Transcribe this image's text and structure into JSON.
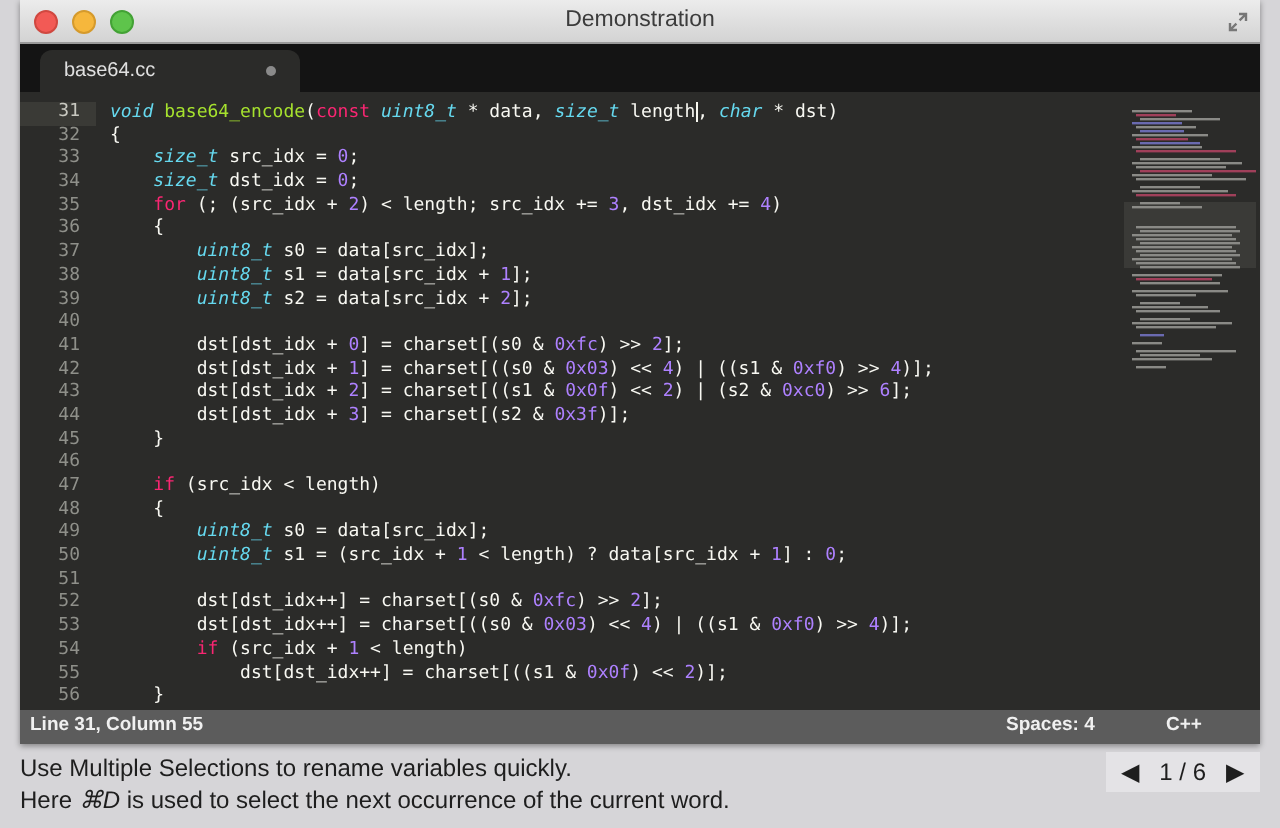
{
  "window": {
    "title": "Demonstration"
  },
  "tabs": [
    {
      "label": "base64.cc",
      "selected": true,
      "modified": true
    }
  ],
  "editor": {
    "lines": [
      {
        "number": "31",
        "current": true,
        "tokens": [
          {
            "kind": "type",
            "text": "void "
          },
          {
            "kind": "function",
            "text": "base64_encode"
          },
          {
            "kind": "plain",
            "text": "("
          },
          {
            "kind": "keyword",
            "text": "const "
          },
          {
            "kind": "type",
            "text": "uint8_t"
          },
          {
            "kind": "plain",
            "text": " * data, "
          },
          {
            "kind": "type",
            "text": "size_t"
          },
          {
            "kind": "plain",
            "text": " length"
          },
          {
            "kind": "cursor"
          },
          {
            "kind": "plain",
            "text": ", "
          },
          {
            "kind": "type",
            "text": "char"
          },
          {
            "kind": "plain",
            "text": " * dst)"
          }
        ]
      },
      {
        "number": "32",
        "current": false,
        "tokens": [
          {
            "kind": "plain",
            "text": "{"
          }
        ]
      },
      {
        "number": "33",
        "current": false,
        "tokens": [
          {
            "kind": "type",
            "text": "    size_t"
          },
          {
            "kind": "plain",
            "text": " src_idx = "
          },
          {
            "kind": "number",
            "text": "0"
          },
          {
            "kind": "plain",
            "text": ";"
          }
        ]
      },
      {
        "number": "34",
        "current": false,
        "tokens": [
          {
            "kind": "type",
            "text": "    size_t"
          },
          {
            "kind": "plain",
            "text": " dst_idx = "
          },
          {
            "kind": "number",
            "text": "0"
          },
          {
            "kind": "plain",
            "text": ";"
          }
        ]
      },
      {
        "number": "35",
        "current": false,
        "tokens": [
          {
            "kind": "keyword",
            "text": "    for"
          },
          {
            "kind": "plain",
            "text": " (; (src_idx + "
          },
          {
            "kind": "number",
            "text": "2"
          },
          {
            "kind": "plain",
            "text": ") < length; src_idx += "
          },
          {
            "kind": "number",
            "text": "3"
          },
          {
            "kind": "plain",
            "text": ", dst_idx += "
          },
          {
            "kind": "number",
            "text": "4"
          },
          {
            "kind": "plain",
            "text": ")"
          }
        ]
      },
      {
        "number": "36",
        "current": false,
        "tokens": [
          {
            "kind": "plain",
            "text": "    {"
          }
        ]
      },
      {
        "number": "37",
        "current": false,
        "tokens": [
          {
            "kind": "type",
            "text": "        uint8_t"
          },
          {
            "kind": "plain",
            "text": " s0 = data[src_idx];"
          }
        ]
      },
      {
        "number": "38",
        "current": false,
        "tokens": [
          {
            "kind": "type",
            "text": "        uint8_t"
          },
          {
            "kind": "plain",
            "text": " s1 = data[src_idx + "
          },
          {
            "kind": "number",
            "text": "1"
          },
          {
            "kind": "plain",
            "text": "];"
          }
        ]
      },
      {
        "number": "39",
        "current": false,
        "tokens": [
          {
            "kind": "type",
            "text": "        uint8_t"
          },
          {
            "kind": "plain",
            "text": " s2 = data[src_idx + "
          },
          {
            "kind": "number",
            "text": "2"
          },
          {
            "kind": "plain",
            "text": "];"
          }
        ]
      },
      {
        "number": "40",
        "current": false
      },
      {
        "number": "41",
        "current": false,
        "tokens": [
          {
            "kind": "plain",
            "text": "        dst[dst_idx + "
          },
          {
            "kind": "number",
            "text": "0"
          },
          {
            "kind": "plain",
            "text": "] = charset[(s0 & "
          },
          {
            "kind": "number",
            "text": "0xfc"
          },
          {
            "kind": "plain",
            "text": ") >> "
          },
          {
            "kind": "number",
            "text": "2"
          },
          {
            "kind": "plain",
            "text": "];"
          }
        ]
      },
      {
        "number": "42",
        "current": false,
        "tokens": [
          {
            "kind": "plain",
            "text": "        dst[dst_idx + "
          },
          {
            "kind": "number",
            "text": "1"
          },
          {
            "kind": "plain",
            "text": "] = charset[((s0 & "
          },
          {
            "kind": "number",
            "text": "0x03"
          },
          {
            "kind": "plain",
            "text": ") << "
          },
          {
            "kind": "number",
            "text": "4"
          },
          {
            "kind": "plain",
            "text": ") | ((s1 & "
          },
          {
            "kind": "number",
            "text": "0xf0"
          },
          {
            "kind": "plain",
            "text": ") >> "
          },
          {
            "kind": "number",
            "text": "4"
          },
          {
            "kind": "plain",
            "text": ")];"
          }
        ]
      },
      {
        "number": "43",
        "current": false,
        "tokens": [
          {
            "kind": "plain",
            "text": "        dst[dst_idx + "
          },
          {
            "kind": "number",
            "text": "2"
          },
          {
            "kind": "plain",
            "text": "] = charset[((s1 & "
          },
          {
            "kind": "number",
            "text": "0x0f"
          },
          {
            "kind": "plain",
            "text": ") << "
          },
          {
            "kind": "number",
            "text": "2"
          },
          {
            "kind": "plain",
            "text": ") | (s2 & "
          },
          {
            "kind": "number",
            "text": "0xc0"
          },
          {
            "kind": "plain",
            "text": ") >> "
          },
          {
            "kind": "number",
            "text": "6"
          },
          {
            "kind": "plain",
            "text": "];"
          }
        ]
      },
      {
        "number": "44",
        "current": false,
        "tokens": [
          {
            "kind": "plain",
            "text": "        dst[dst_idx + "
          },
          {
            "kind": "number",
            "text": "3"
          },
          {
            "kind": "plain",
            "text": "] = charset[(s2 & "
          },
          {
            "kind": "number",
            "text": "0x3f"
          },
          {
            "kind": "plain",
            "text": ")];"
          }
        ]
      },
      {
        "number": "45",
        "current": false,
        "tokens": [
          {
            "kind": "plain",
            "text": "    }"
          }
        ]
      },
      {
        "number": "46",
        "current": false
      },
      {
        "number": "47",
        "current": false,
        "tokens": [
          {
            "kind": "keyword",
            "text": "    if"
          },
          {
            "kind": "plain",
            "text": " (src_idx < length)"
          }
        ]
      },
      {
        "number": "48",
        "current": false,
        "tokens": [
          {
            "kind": "plain",
            "text": "    {"
          }
        ]
      },
      {
        "number": "49",
        "current": false,
        "tokens": [
          {
            "kind": "type",
            "text": "        uint8_t"
          },
          {
            "kind": "plain",
            "text": " s0 = data[src_idx];"
          }
        ]
      },
      {
        "number": "50",
        "current": false,
        "tokens": [
          {
            "kind": "type",
            "text": "        uint8_t"
          },
          {
            "kind": "plain",
            "text": " s1 = (src_idx + "
          },
          {
            "kind": "number",
            "text": "1"
          },
          {
            "kind": "plain",
            "text": " < length) ? data[src_idx + "
          },
          {
            "kind": "number",
            "text": "1"
          },
          {
            "kind": "plain",
            "text": "] : "
          },
          {
            "kind": "number",
            "text": "0"
          },
          {
            "kind": "plain",
            "text": ";"
          }
        ]
      },
      {
        "number": "51",
        "current": false
      },
      {
        "number": "52",
        "current": false,
        "tokens": [
          {
            "kind": "plain",
            "text": "        dst[dst_idx++] = charset[(s0 & "
          },
          {
            "kind": "number",
            "text": "0xfc"
          },
          {
            "kind": "plain",
            "text": ") >> "
          },
          {
            "kind": "number",
            "text": "2"
          },
          {
            "kind": "plain",
            "text": "];"
          }
        ]
      },
      {
        "number": "53",
        "current": false,
        "tokens": [
          {
            "kind": "plain",
            "text": "        dst[dst_idx++] = charset[((s0 & "
          },
          {
            "kind": "number",
            "text": "0x03"
          },
          {
            "kind": "plain",
            "text": ") << "
          },
          {
            "kind": "number",
            "text": "4"
          },
          {
            "kind": "plain",
            "text": ") | ((s1 & "
          },
          {
            "kind": "number",
            "text": "0xf0"
          },
          {
            "kind": "plain",
            "text": ") >> "
          },
          {
            "kind": "number",
            "text": "4"
          },
          {
            "kind": "plain",
            "text": ")];"
          }
        ]
      },
      {
        "number": "54",
        "current": false,
        "tokens": [
          {
            "kind": "keyword",
            "text": "        if"
          },
          {
            "kind": "plain",
            "text": " (src_idx + "
          },
          {
            "kind": "number",
            "text": "1"
          },
          {
            "kind": "plain",
            "text": " < length)"
          }
        ]
      },
      {
        "number": "55",
        "current": false,
        "tokens": [
          {
            "kind": "plain",
            "text": "            dst[dst_idx++] = charset[((s1 & "
          },
          {
            "kind": "number",
            "text": "0x0f"
          },
          {
            "kind": "plain",
            "text": ") << "
          },
          {
            "kind": "number",
            "text": "2"
          },
          {
            "kind": "plain",
            "text": ")];"
          }
        ]
      },
      {
        "number": "56",
        "current": false,
        "tokens": [
          {
            "kind": "plain",
            "text": "    }"
          }
        ]
      }
    ]
  },
  "status_bar": {
    "position": "Line 31, Column 55",
    "indentation": "Spaces: 4",
    "syntax": "C++"
  },
  "caption": {
    "lines": [
      "Use Multiple Selections to rename variables quickly.",
      "Here *⌘D* is used to select the next occurrence of the current word."
    ]
  },
  "pager": {
    "previous": "◀",
    "page": "1 / 6",
    "next": "▶"
  }
}
